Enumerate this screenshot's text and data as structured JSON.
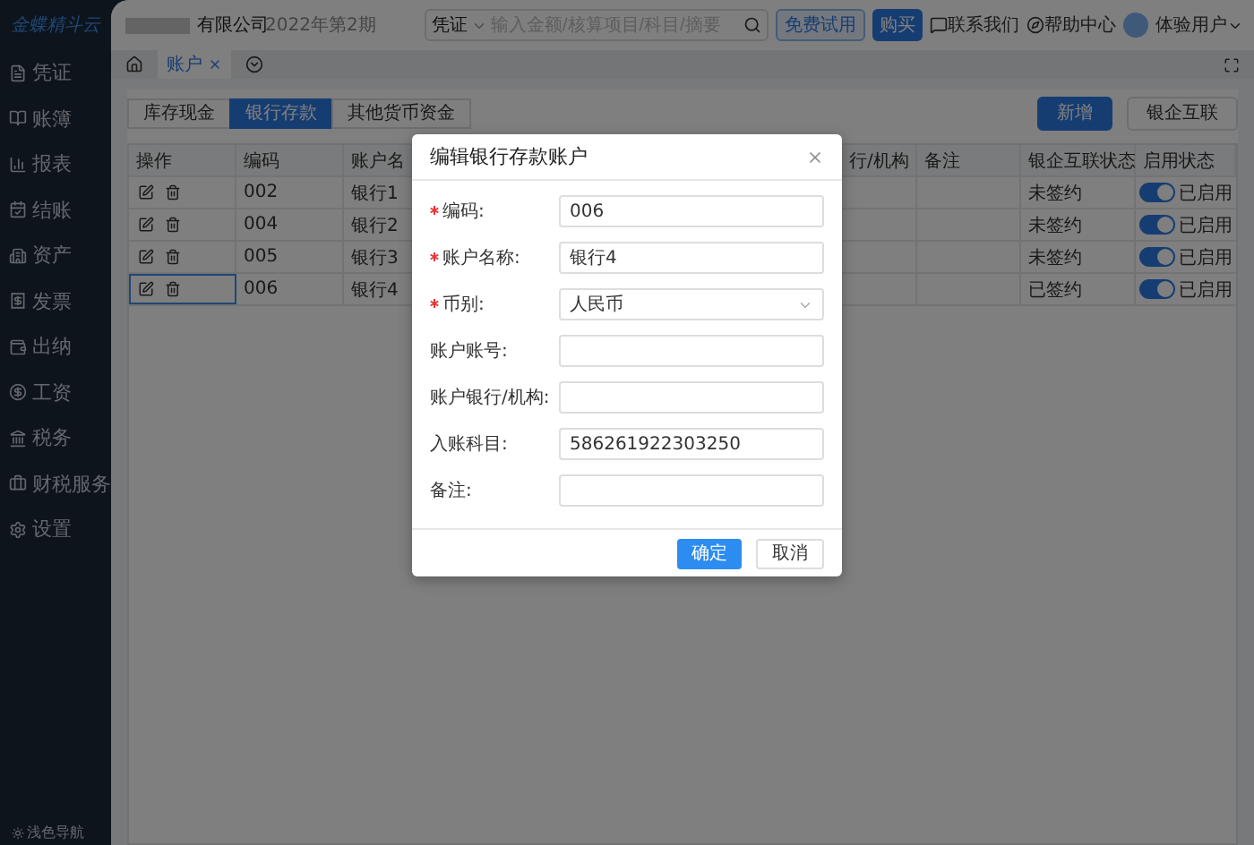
{
  "logo": {
    "text": "金蝶精斗云"
  },
  "sidebar": {
    "items": [
      {
        "label": "凭证",
        "selected": false
      },
      {
        "label": "账簿",
        "selected": false
      },
      {
        "label": "报表",
        "selected": false
      },
      {
        "label": "结账",
        "selected": false
      },
      {
        "label": "资产",
        "selected": false
      },
      {
        "label": "发票",
        "selected": false
      },
      {
        "label": "出纳",
        "selected": false
      },
      {
        "label": "工资",
        "selected": false
      },
      {
        "label": "税务",
        "selected": false
      },
      {
        "label": "财税服务",
        "selected": false
      },
      {
        "label": "设置",
        "selected": false
      }
    ],
    "footer": "浅色导航"
  },
  "header": {
    "company": "有限公司",
    "period": "2022年第2期",
    "search_type": "凭证",
    "search": {
      "placeholder": "输入金额/核算项目/科目/摘要"
    },
    "trial_button": "免费试用",
    "buy_button": "购买",
    "contact": "联系我们",
    "help": "帮助中心",
    "user": "体验用户"
  },
  "page_tabs": [
    {
      "label": "账户",
      "selected": true
    }
  ],
  "sub_tabs": [
    {
      "label": "库存现金",
      "selected": false
    },
    {
      "label": "银行存款",
      "selected": true
    },
    {
      "label": "其他货币资金",
      "selected": false
    }
  ],
  "actions": [
    "新增",
    "银企互联"
  ],
  "table": {
    "columns": [
      "操作",
      "编码",
      "账户名",
      "行/机构",
      "备注",
      "银企互联状态",
      "启用状态"
    ],
    "rows": [
      {
        "code": "002",
        "name": "银行1",
        "link_status": "未签约",
        "enabled": true,
        "enabled_label": "已启用",
        "focused": false
      },
      {
        "code": "004",
        "name": "银行2",
        "link_status": "未签约",
        "enabled": true,
        "enabled_label": "已启用",
        "focused": false
      },
      {
        "code": "005",
        "name": "银行3",
        "link_status": "未签约",
        "enabled": true,
        "enabled_label": "已启用",
        "focused": false
      },
      {
        "code": "006",
        "name": "银行4",
        "link_status": "已签约",
        "enabled": true,
        "enabled_label": "已启用",
        "focused": true
      }
    ]
  },
  "dialog": {
    "title": "编辑银行存款账户",
    "fields": [
      {
        "label": "编码:",
        "required": true,
        "kind": "input",
        "value": "006"
      },
      {
        "label": "账户名称:",
        "required": true,
        "kind": "input",
        "value": "银行4"
      },
      {
        "label": "币别:",
        "required": true,
        "kind": "select",
        "value": "人民币"
      },
      {
        "label": "账户账号:",
        "required": false,
        "kind": "input"
      },
      {
        "label": "账户银行/机构:",
        "required": false,
        "kind": "input"
      },
      {
        "label": "入账科目:",
        "required": false,
        "kind": "input",
        "value": "586261922303250"
      },
      {
        "label": "备注:",
        "required": false,
        "kind": "input"
      }
    ],
    "ok": "确定",
    "cancel": "取消"
  }
}
